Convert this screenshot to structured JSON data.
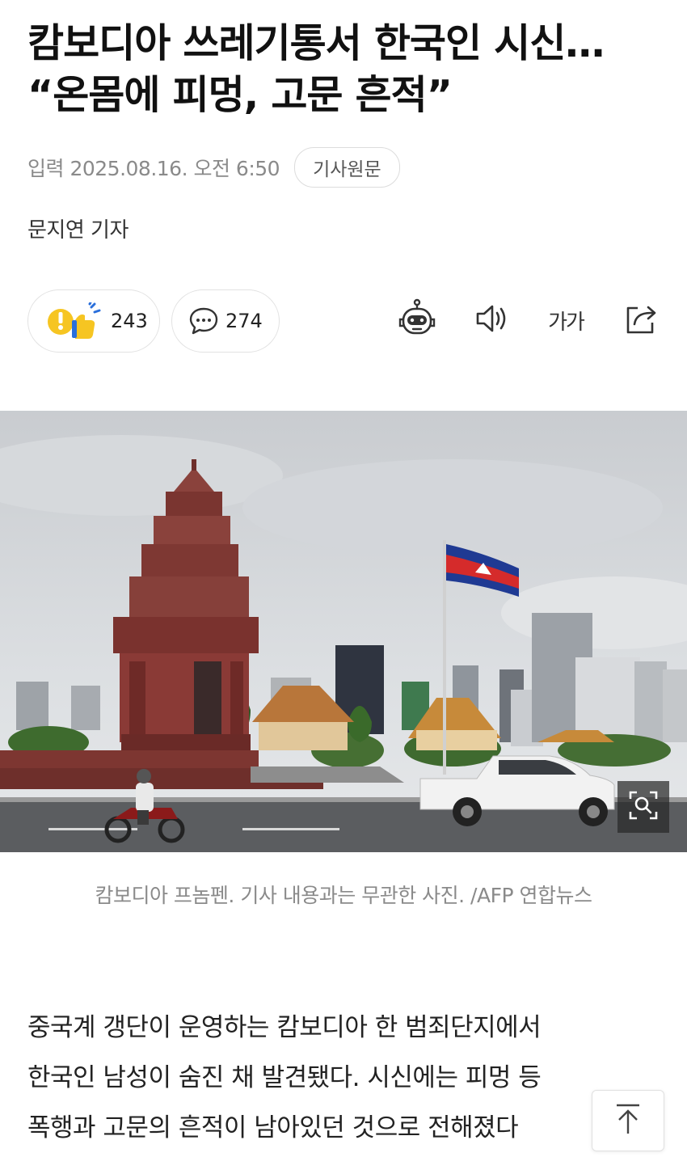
{
  "article": {
    "title": "캄보디아 쓰레기통서 한국인 시신… “온몸에 피멍, 고문 흔적”",
    "date_label": "입력 2025.08.16. 오전 6:50",
    "original_button": "기사원문",
    "reporter": "문지연 기자"
  },
  "reactions": {
    "like_count": "243",
    "comment_count": "274"
  },
  "tools": {
    "font_size_label": "가가",
    "icons": [
      "robot-summary-icon",
      "speaker-icon",
      "font-size-icon",
      "share-icon"
    ]
  },
  "photo": {
    "caption": "캄보디아 프놈펜. 기사 내용과는 무관한 사진. /AFP 연합뉴스"
  },
  "body": {
    "line1": "중국계 갱단이 운영하는 캄보디아 한 범죄단지에서",
    "line2": "한국인 남성이 숨진 채 발견됐다. 시신에는 피멍 등",
    "line3": "폭행과 고문의 흔적이 남아있던 것으로 전해졌다"
  },
  "colors": {
    "flag_blue": "#1f3a93",
    "flag_red": "#d52b2b",
    "monument": "#8a3a36",
    "reaction_yellow": "#f6c522"
  }
}
